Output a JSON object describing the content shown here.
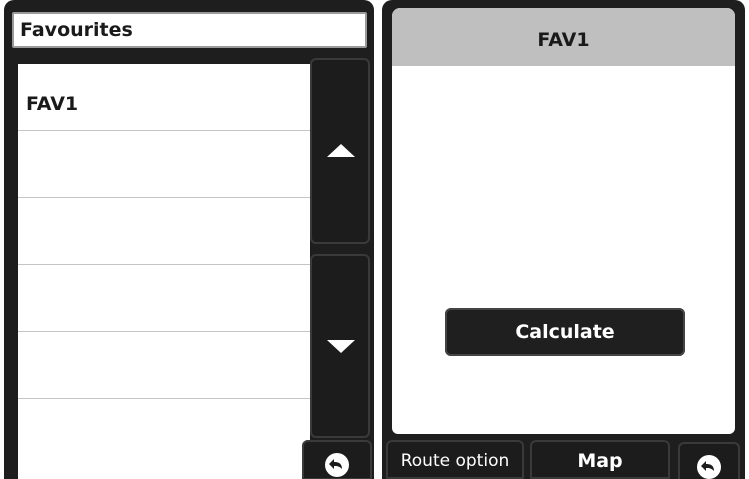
{
  "favourites": {
    "title": "Favourites",
    "items": [
      {
        "label": "FAV1"
      },
      {
        "label": ""
      },
      {
        "label": ""
      },
      {
        "label": ""
      },
      {
        "label": ""
      },
      {
        "label": ""
      }
    ]
  },
  "scroll": {
    "up_icon": "triangle-up-icon",
    "down_icon": "triangle-down-icon"
  },
  "detail": {
    "title": "FAV1",
    "calculate_label": "Calculate"
  },
  "bottom_bar": {
    "route_option_label": "Route option",
    "map_label": "Map",
    "back_icon": "back-arrow-icon"
  },
  "colors": {
    "bezel": "#1e1e1e",
    "title_bar": "#bfbfbf",
    "text": "#1a1a1a"
  }
}
